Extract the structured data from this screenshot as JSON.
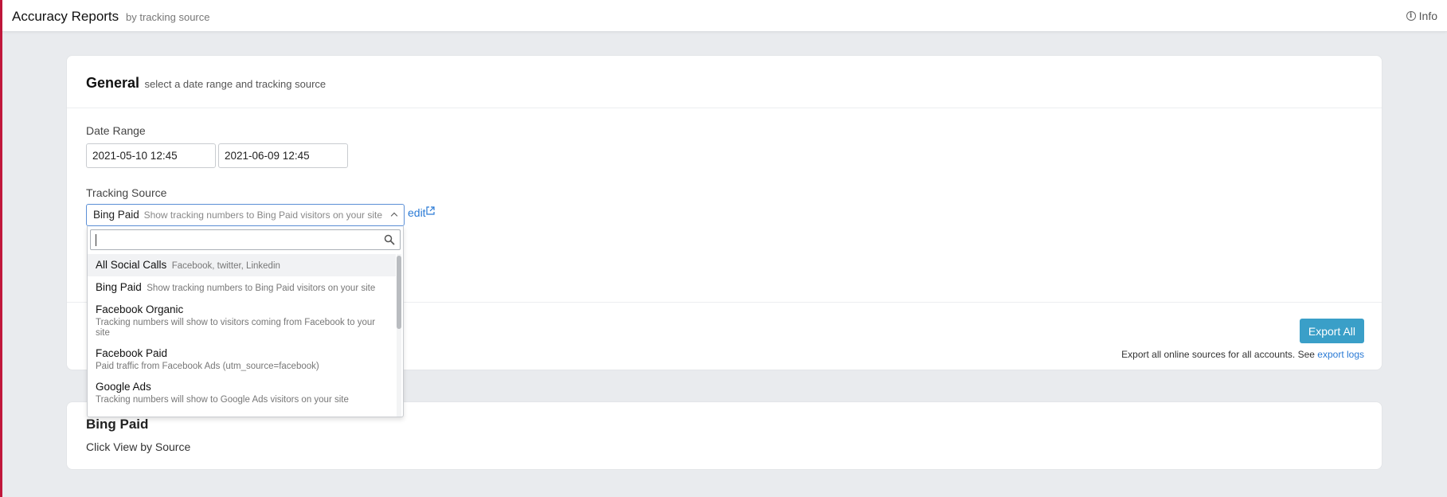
{
  "header": {
    "title": "Accuracy Reports",
    "subtitle": "by tracking source",
    "info_label": "Info"
  },
  "general": {
    "title": "General",
    "subtitle": "select a date range and tracking source",
    "date_range_label": "Date Range",
    "date_start": "2021-05-10 12:45",
    "date_end": "2021-06-09 12:45",
    "tracking_source_label": "Tracking Source",
    "selected_source": "Bing Paid",
    "selected_source_desc": "Show tracking numbers to Bing Paid visitors on your site",
    "edit_label": "edit",
    "export_button": "Export All",
    "export_note": "Export all online sources for all accounts. See",
    "export_logs_link": "export logs"
  },
  "dropdown": {
    "search_value": "",
    "items": [
      {
        "title": "All Social Calls",
        "desc": "Facebook, twitter, Linkedin"
      },
      {
        "title": "Bing Paid",
        "desc": "Show tracking numbers to Bing Paid visitors on your site"
      },
      {
        "title": "Facebook Organic",
        "desc": "Tracking numbers will show to visitors coming from Facebook to your site"
      },
      {
        "title": "Facebook Paid",
        "desc": "Paid traffic from Facebook Ads (utm_source=facebook)"
      },
      {
        "title": "Google Ads",
        "desc": "Tracking numbers will show to Google Ads visitors on your site"
      }
    ]
  },
  "report": {
    "title": "Bing Paid",
    "subtitle": "Click View by Source"
  },
  "colors": {
    "accent_bar": "#c0173b",
    "primary_button": "#3a9fc8",
    "link": "#2a7ad5"
  }
}
